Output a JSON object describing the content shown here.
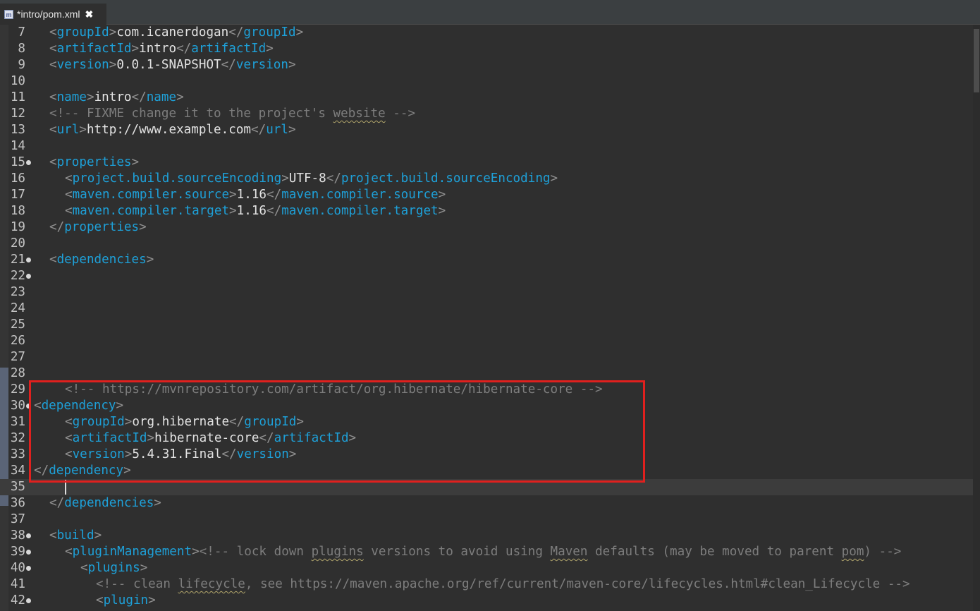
{
  "tab": {
    "file_icon": "m-icon",
    "title": "*intro/pom.xml",
    "close_label": "✖"
  },
  "editor": {
    "current_line": 35,
    "lines": [
      {
        "n": "7",
        "i": 1,
        "parts": [
          [
            "b",
            "<"
          ],
          [
            "t",
            "groupId"
          ],
          [
            "b",
            ">"
          ],
          [
            "x",
            "com.icanerdogan"
          ],
          [
            "b",
            "</"
          ],
          [
            "t",
            "groupId"
          ],
          [
            "b",
            ">"
          ]
        ]
      },
      {
        "n": "8",
        "i": 1,
        "parts": [
          [
            "b",
            "<"
          ],
          [
            "t",
            "artifactId"
          ],
          [
            "b",
            ">"
          ],
          [
            "x",
            "intro"
          ],
          [
            "b",
            "</"
          ],
          [
            "t",
            "artifactId"
          ],
          [
            "b",
            ">"
          ]
        ]
      },
      {
        "n": "9",
        "i": 1,
        "parts": [
          [
            "b",
            "<"
          ],
          [
            "t",
            "version"
          ],
          [
            "b",
            ">"
          ],
          [
            "x",
            "0.0.1-SNAPSHOT"
          ],
          [
            "b",
            "</"
          ],
          [
            "t",
            "version"
          ],
          [
            "b",
            ">"
          ]
        ]
      },
      {
        "n": "10",
        "i": 0,
        "parts": []
      },
      {
        "n": "11",
        "i": 1,
        "parts": [
          [
            "b",
            "<"
          ],
          [
            "t",
            "name"
          ],
          [
            "b",
            ">"
          ],
          [
            "x",
            "intro"
          ],
          [
            "b",
            "</"
          ],
          [
            "t",
            "name"
          ],
          [
            "b",
            ">"
          ]
        ]
      },
      {
        "n": "12",
        "i": 1,
        "parts": [
          [
            "c",
            "<!-- FIXME change it to the project's "
          ],
          [
            "cu",
            "website"
          ],
          [
            "c",
            " -->"
          ]
        ]
      },
      {
        "n": "13",
        "i": 1,
        "parts": [
          [
            "b",
            "<"
          ],
          [
            "t",
            "url"
          ],
          [
            "b",
            ">"
          ],
          [
            "x",
            "http://www.example.com"
          ],
          [
            "b",
            "</"
          ],
          [
            "t",
            "url"
          ],
          [
            "b",
            ">"
          ]
        ]
      },
      {
        "n": "14",
        "i": 0,
        "parts": []
      },
      {
        "n": "15",
        "i": 1,
        "fold": true,
        "parts": [
          [
            "b",
            "<"
          ],
          [
            "t",
            "properties"
          ],
          [
            "b",
            ">"
          ]
        ]
      },
      {
        "n": "16",
        "i": 2,
        "parts": [
          [
            "b",
            "<"
          ],
          [
            "t",
            "project.build.sourceEncoding"
          ],
          [
            "b",
            ">"
          ],
          [
            "x",
            "UTF-8"
          ],
          [
            "b",
            "</"
          ],
          [
            "t",
            "project.build.sourceEncoding"
          ],
          [
            "b",
            ">"
          ]
        ]
      },
      {
        "n": "17",
        "i": 2,
        "parts": [
          [
            "b",
            "<"
          ],
          [
            "t",
            "maven.compiler.source"
          ],
          [
            "b",
            ">"
          ],
          [
            "x",
            "1.16"
          ],
          [
            "b",
            "</"
          ],
          [
            "t",
            "maven.compiler.source"
          ],
          [
            "b",
            ">"
          ]
        ]
      },
      {
        "n": "18",
        "i": 2,
        "parts": [
          [
            "b",
            "<"
          ],
          [
            "t",
            "maven.compiler.target"
          ],
          [
            "b",
            ">"
          ],
          [
            "x",
            "1.16"
          ],
          [
            "b",
            "</"
          ],
          [
            "t",
            "maven.compiler.target"
          ],
          [
            "b",
            ">"
          ]
        ]
      },
      {
        "n": "19",
        "i": 1,
        "parts": [
          [
            "b",
            "</"
          ],
          [
            "t",
            "properties"
          ],
          [
            "b",
            ">"
          ]
        ]
      },
      {
        "n": "20",
        "i": 0,
        "parts": []
      },
      {
        "n": "21",
        "i": 1,
        "fold": true,
        "parts": [
          [
            "b",
            "<"
          ],
          [
            "t",
            "dependencies"
          ],
          [
            "b",
            ">"
          ]
        ]
      },
      {
        "n": "22",
        "i": 0,
        "fold": true,
        "parts": []
      },
      {
        "n": "23",
        "i": 0,
        "parts": []
      },
      {
        "n": "24",
        "i": 0,
        "parts": []
      },
      {
        "n": "25",
        "i": 0,
        "parts": []
      },
      {
        "n": "26",
        "i": 0,
        "parts": []
      },
      {
        "n": "27",
        "i": 0,
        "parts": []
      },
      {
        "n": "28",
        "i": 0,
        "parts": []
      },
      {
        "n": "29",
        "i": 2,
        "parts": [
          [
            "c",
            "<!-- https://mvnrepository.com/artifact/org.hibernate/hibernate-core -->"
          ]
        ]
      },
      {
        "n": "30",
        "i": 0,
        "fold": true,
        "parts": [
          [
            "b",
            "<"
          ],
          [
            "t",
            "dependency"
          ],
          [
            "b",
            ">"
          ]
        ]
      },
      {
        "n": "31",
        "i": 2,
        "parts": [
          [
            "b",
            "<"
          ],
          [
            "t",
            "groupId"
          ],
          [
            "b",
            ">"
          ],
          [
            "x",
            "org.hibernate"
          ],
          [
            "b",
            "</"
          ],
          [
            "t",
            "groupId"
          ],
          [
            "b",
            ">"
          ]
        ]
      },
      {
        "n": "32",
        "i": 2,
        "parts": [
          [
            "b",
            "<"
          ],
          [
            "t",
            "artifactId"
          ],
          [
            "b",
            ">"
          ],
          [
            "x",
            "hibernate-core"
          ],
          [
            "b",
            "</"
          ],
          [
            "t",
            "artifactId"
          ],
          [
            "b",
            ">"
          ]
        ]
      },
      {
        "n": "33",
        "i": 2,
        "parts": [
          [
            "b",
            "<"
          ],
          [
            "t",
            "version"
          ],
          [
            "b",
            ">"
          ],
          [
            "x",
            "5.4.31.Final"
          ],
          [
            "b",
            "</"
          ],
          [
            "t",
            "version"
          ],
          [
            "b",
            ">"
          ]
        ]
      },
      {
        "n": "34",
        "i": 0,
        "parts": [
          [
            "b",
            "</"
          ],
          [
            "t",
            "dependency"
          ],
          [
            "b",
            ">"
          ]
        ]
      },
      {
        "n": "35",
        "i": 0,
        "parts": []
      },
      {
        "n": "36",
        "i": 1,
        "parts": [
          [
            "b",
            "</"
          ],
          [
            "t",
            "dependencies"
          ],
          [
            "b",
            ">"
          ]
        ]
      },
      {
        "n": "37",
        "i": 0,
        "parts": []
      },
      {
        "n": "38",
        "i": 1,
        "fold": true,
        "parts": [
          [
            "b",
            "<"
          ],
          [
            "t",
            "build"
          ],
          [
            "b",
            ">"
          ]
        ]
      },
      {
        "n": "39",
        "i": 2,
        "fold": true,
        "parts": [
          [
            "b",
            "<"
          ],
          [
            "t",
            "pluginManagement"
          ],
          [
            "b",
            ">"
          ],
          [
            "c",
            "<!-- lock down "
          ],
          [
            "cu",
            "plugins"
          ],
          [
            "c",
            " versions to avoid using "
          ],
          [
            "cu",
            "Maven"
          ],
          [
            "c",
            " defaults (may be moved to parent "
          ],
          [
            "cu",
            "pom"
          ],
          [
            "c",
            ") -->"
          ]
        ]
      },
      {
        "n": "40",
        "i": 3,
        "fold": true,
        "parts": [
          [
            "b",
            "<"
          ],
          [
            "t",
            "plugins"
          ],
          [
            "b",
            ">"
          ]
        ]
      },
      {
        "n": "41",
        "i": 4,
        "parts": [
          [
            "c",
            "<!-- clean "
          ],
          [
            "cu",
            "lifecycle"
          ],
          [
            "c",
            ", see https://maven.apache.org/ref/current/maven-core/lifecycles.html#clean_Lifecycle -->"
          ]
        ]
      },
      {
        "n": "42",
        "i": 4,
        "fold": true,
        "parts": [
          [
            "b",
            "<"
          ],
          [
            "t",
            "plugin"
          ],
          [
            "b",
            ">"
          ]
        ]
      }
    ]
  }
}
